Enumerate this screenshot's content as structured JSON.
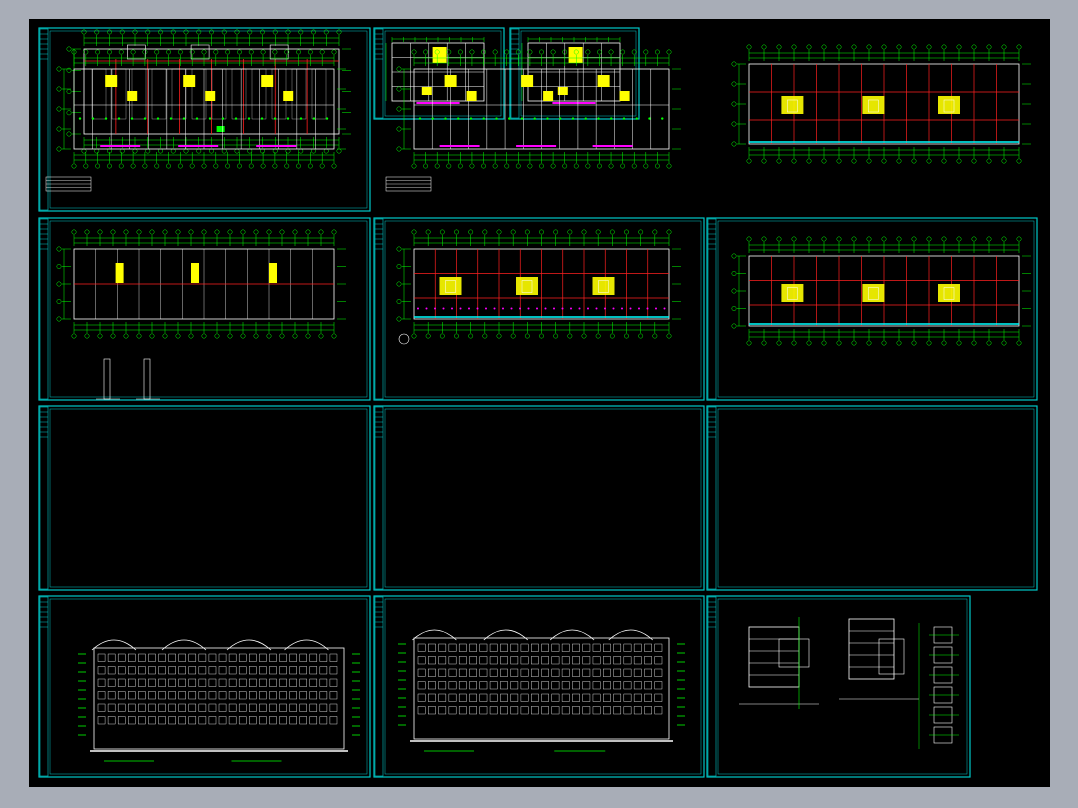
{
  "colors": {
    "window_bg": "#a8adb7",
    "canvas_bg": "#000000",
    "frame": "#00c8c8",
    "linework": "#ffffff",
    "dimension": "#00ff00",
    "grid_axis": "#ff2020",
    "fill_core": "#ffff00",
    "opening": "#ff00ff",
    "wall": "#00ffff"
  },
  "sheets": [
    {
      "id": "sheet-roof-plan",
      "kind": "plan"
    },
    {
      "id": "sheet-unit-plan-a",
      "kind": "unit"
    },
    {
      "id": "sheet-unit-plan-b",
      "kind": "unit"
    },
    {
      "id": "sheet-typical-floor-plan-1",
      "kind": "plan-detailed"
    },
    {
      "id": "sheet-typical-floor-plan-2",
      "kind": "plan-detailed"
    },
    {
      "id": "sheet-structural-grid-1",
      "kind": "grid"
    },
    {
      "id": "sheet-ground-floor-plan",
      "kind": "plan-sparse"
    },
    {
      "id": "sheet-first-floor-plan",
      "kind": "plan-grid"
    },
    {
      "id": "sheet-structural-grid-2",
      "kind": "grid"
    },
    {
      "id": "sheet-front-elevation",
      "kind": "elevation"
    },
    {
      "id": "sheet-rear-elevation",
      "kind": "elevation"
    },
    {
      "id": "sheet-sections-details",
      "kind": "section"
    }
  ]
}
